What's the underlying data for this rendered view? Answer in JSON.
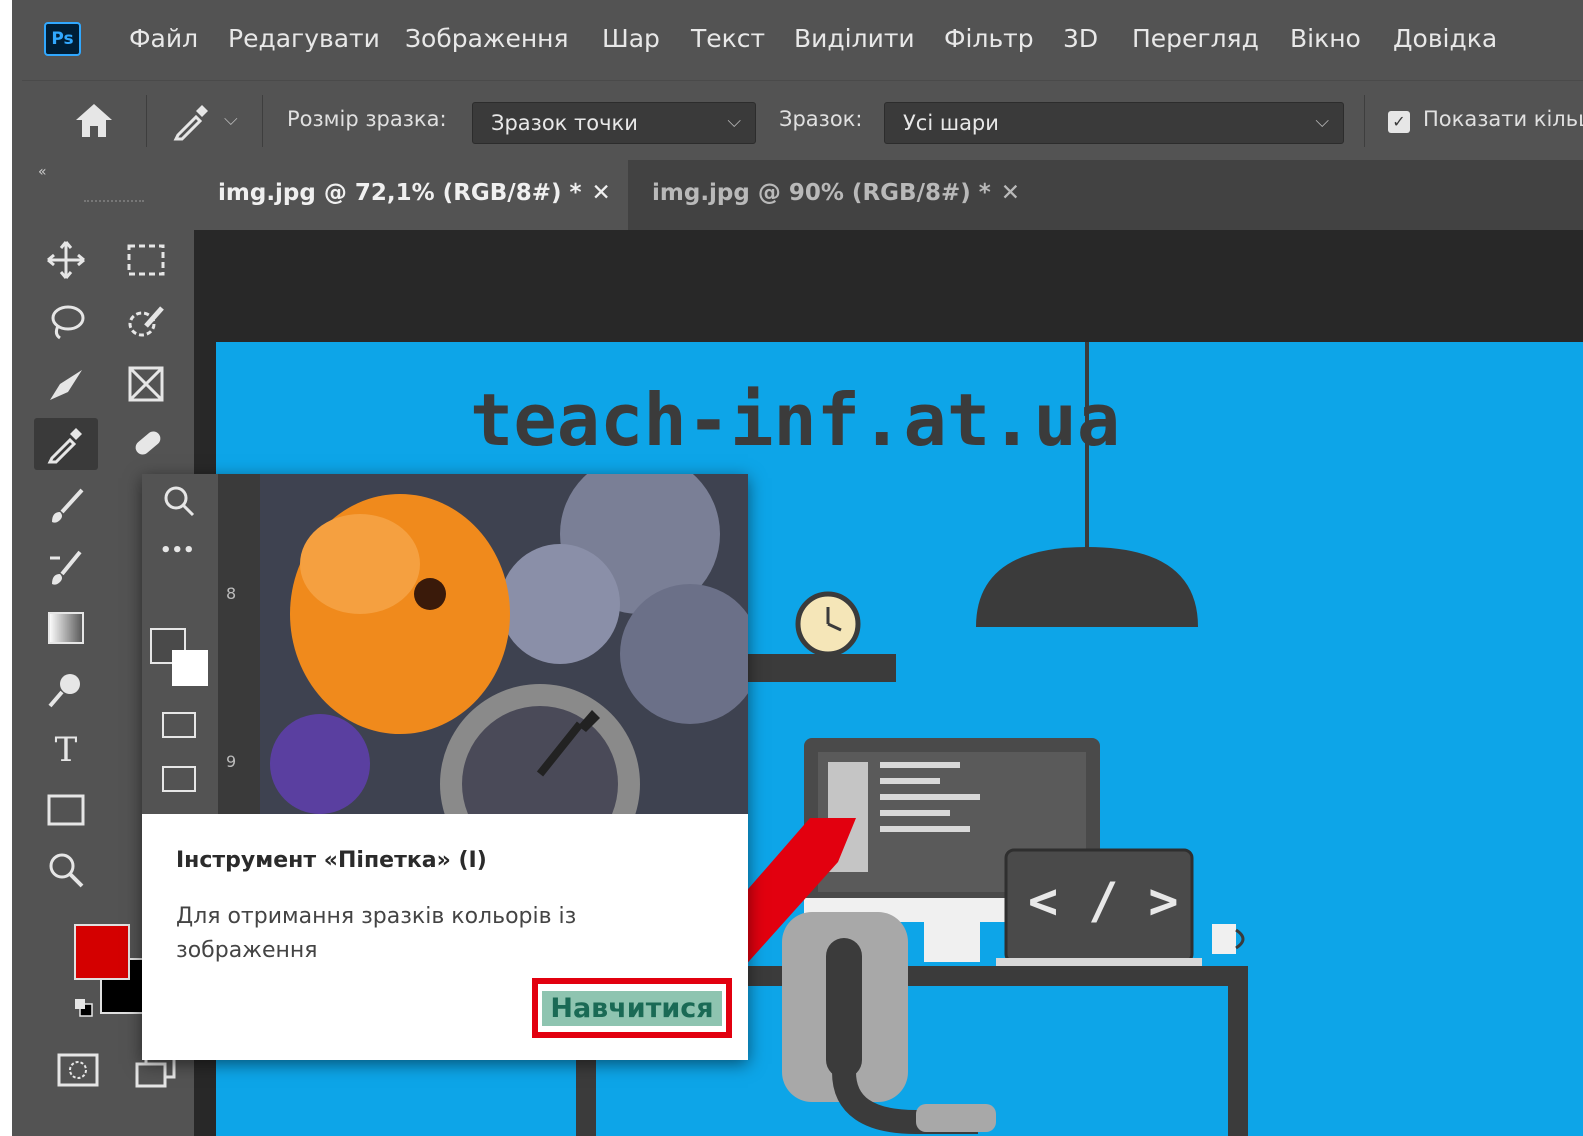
{
  "menubar": {
    "logo": "Ps",
    "items": [
      "Файл",
      "Редагувати",
      "Зображення",
      "Шар",
      "Текст",
      "Виділити",
      "Фільтр",
      "3D",
      "Перегляд",
      "Вікно",
      "Довідка"
    ]
  },
  "options": {
    "sample_size_label": "Розмір зразка:",
    "sample_size_value": "Зразок точки",
    "sample_label": "Зразок:",
    "sample_value": "Усі шари",
    "show_ring_label": "Показати кільце"
  },
  "tabs": [
    {
      "label": "img.jpg @ 72,1% (RGB/8#) *",
      "active": true
    },
    {
      "label": "img.jpg @ 90% (RGB/8#) *",
      "active": false
    }
  ],
  "canvas": {
    "site_title": "teach-inf.at.ua",
    "code_tag": "< / >"
  },
  "tooltip": {
    "title": "Інструмент «Піпетка» (I)",
    "description": "Для отримання зразків кольорів із зображення",
    "learn_button": "Навчитися",
    "ruler_marks": [
      "8",
      "9"
    ]
  },
  "colors": {
    "foreground": "#d40000",
    "background": "#000000",
    "image_bg": "#0da5e8",
    "highlight": "#e2000f"
  }
}
